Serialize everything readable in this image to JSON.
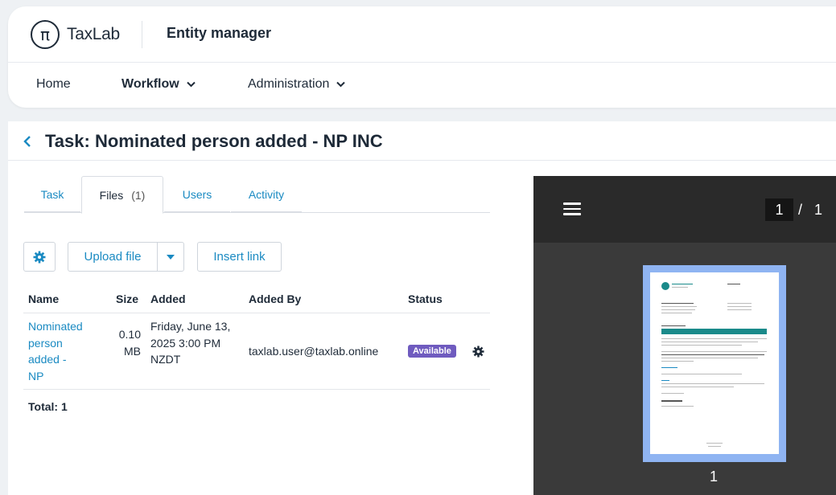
{
  "header": {
    "logo_glyph": "π",
    "logo_text": "TaxLab",
    "app_title": "Entity manager"
  },
  "nav": {
    "items": [
      {
        "label": "Home"
      },
      {
        "label": "Workflow"
      },
      {
        "label": "Administration"
      }
    ]
  },
  "page": {
    "title": "Task: Nominated person added - NP INC"
  },
  "tabs": [
    {
      "label": "Task"
    },
    {
      "label": "Files",
      "count": "(1)"
    },
    {
      "label": "Users"
    },
    {
      "label": "Activity"
    }
  ],
  "toolbar": {
    "upload_label": "Upload file",
    "insert_link_label": "Insert link"
  },
  "table": {
    "headers": [
      "Name",
      "Size",
      "Added",
      "Added By",
      "Status"
    ],
    "rows": [
      {
        "name": [
          "Nominated",
          "person",
          "added -",
          "NP"
        ],
        "size": [
          "0.10",
          "MB"
        ],
        "added": [
          "Friday, June 13,",
          "2025 3:00 PM",
          "NZDT"
        ],
        "added_by": "taxlab.user@taxlab.online",
        "status": "Available"
      }
    ],
    "total": "Total: 1"
  },
  "viewer": {
    "current_page": "1",
    "separator": "/",
    "total_pages": "1",
    "thumb_label": "1"
  },
  "colors": {
    "accent": "#1a8ac2",
    "status_badge": "#6f5bbf",
    "viewer_bg": "#3a3a3a",
    "thumb_border": "#8fb4f2"
  }
}
